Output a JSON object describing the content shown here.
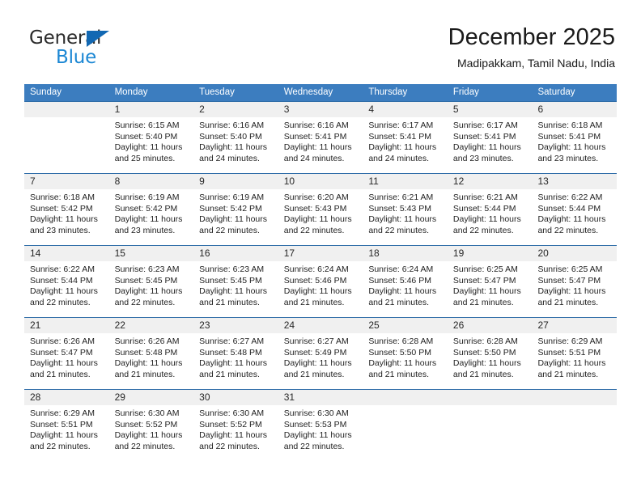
{
  "brand": {
    "name_top": "General",
    "name_bottom": "Blue",
    "accent_color": "#1b87d4",
    "triangle_color": "#1268b3"
  },
  "header": {
    "title": "December 2025",
    "subtitle": "Madipakkam, Tamil Nadu, India"
  },
  "theme": {
    "header_bg": "#3c7dbf",
    "row_divider": "#2f6da8",
    "daynum_band": "#f0f0f0",
    "text": "#1f1f1f"
  },
  "weekdays": [
    "Sunday",
    "Monday",
    "Tuesday",
    "Wednesday",
    "Thursday",
    "Friday",
    "Saturday"
  ],
  "weeks": [
    [
      {
        "day": "",
        "sunrise": "",
        "sunset": "",
        "daylight": ""
      },
      {
        "day": "1",
        "sunrise": "Sunrise: 6:15 AM",
        "sunset": "Sunset: 5:40 PM",
        "daylight": "Daylight: 11 hours and 25 minutes."
      },
      {
        "day": "2",
        "sunrise": "Sunrise: 6:16 AM",
        "sunset": "Sunset: 5:40 PM",
        "daylight": "Daylight: 11 hours and 24 minutes."
      },
      {
        "day": "3",
        "sunrise": "Sunrise: 6:16 AM",
        "sunset": "Sunset: 5:41 PM",
        "daylight": "Daylight: 11 hours and 24 minutes."
      },
      {
        "day": "4",
        "sunrise": "Sunrise: 6:17 AM",
        "sunset": "Sunset: 5:41 PM",
        "daylight": "Daylight: 11 hours and 24 minutes."
      },
      {
        "day": "5",
        "sunrise": "Sunrise: 6:17 AM",
        "sunset": "Sunset: 5:41 PM",
        "daylight": "Daylight: 11 hours and 23 minutes."
      },
      {
        "day": "6",
        "sunrise": "Sunrise: 6:18 AM",
        "sunset": "Sunset: 5:41 PM",
        "daylight": "Daylight: 11 hours and 23 minutes."
      }
    ],
    [
      {
        "day": "7",
        "sunrise": "Sunrise: 6:18 AM",
        "sunset": "Sunset: 5:42 PM",
        "daylight": "Daylight: 11 hours and 23 minutes."
      },
      {
        "day": "8",
        "sunrise": "Sunrise: 6:19 AM",
        "sunset": "Sunset: 5:42 PM",
        "daylight": "Daylight: 11 hours and 23 minutes."
      },
      {
        "day": "9",
        "sunrise": "Sunrise: 6:19 AM",
        "sunset": "Sunset: 5:42 PM",
        "daylight": "Daylight: 11 hours and 22 minutes."
      },
      {
        "day": "10",
        "sunrise": "Sunrise: 6:20 AM",
        "sunset": "Sunset: 5:43 PM",
        "daylight": "Daylight: 11 hours and 22 minutes."
      },
      {
        "day": "11",
        "sunrise": "Sunrise: 6:21 AM",
        "sunset": "Sunset: 5:43 PM",
        "daylight": "Daylight: 11 hours and 22 minutes."
      },
      {
        "day": "12",
        "sunrise": "Sunrise: 6:21 AM",
        "sunset": "Sunset: 5:44 PM",
        "daylight": "Daylight: 11 hours and 22 minutes."
      },
      {
        "day": "13",
        "sunrise": "Sunrise: 6:22 AM",
        "sunset": "Sunset: 5:44 PM",
        "daylight": "Daylight: 11 hours and 22 minutes."
      }
    ],
    [
      {
        "day": "14",
        "sunrise": "Sunrise: 6:22 AM",
        "sunset": "Sunset: 5:44 PM",
        "daylight": "Daylight: 11 hours and 22 minutes."
      },
      {
        "day": "15",
        "sunrise": "Sunrise: 6:23 AM",
        "sunset": "Sunset: 5:45 PM",
        "daylight": "Daylight: 11 hours and 22 minutes."
      },
      {
        "day": "16",
        "sunrise": "Sunrise: 6:23 AM",
        "sunset": "Sunset: 5:45 PM",
        "daylight": "Daylight: 11 hours and 21 minutes."
      },
      {
        "day": "17",
        "sunrise": "Sunrise: 6:24 AM",
        "sunset": "Sunset: 5:46 PM",
        "daylight": "Daylight: 11 hours and 21 minutes."
      },
      {
        "day": "18",
        "sunrise": "Sunrise: 6:24 AM",
        "sunset": "Sunset: 5:46 PM",
        "daylight": "Daylight: 11 hours and 21 minutes."
      },
      {
        "day": "19",
        "sunrise": "Sunrise: 6:25 AM",
        "sunset": "Sunset: 5:47 PM",
        "daylight": "Daylight: 11 hours and 21 minutes."
      },
      {
        "day": "20",
        "sunrise": "Sunrise: 6:25 AM",
        "sunset": "Sunset: 5:47 PM",
        "daylight": "Daylight: 11 hours and 21 minutes."
      }
    ],
    [
      {
        "day": "21",
        "sunrise": "Sunrise: 6:26 AM",
        "sunset": "Sunset: 5:47 PM",
        "daylight": "Daylight: 11 hours and 21 minutes."
      },
      {
        "day": "22",
        "sunrise": "Sunrise: 6:26 AM",
        "sunset": "Sunset: 5:48 PM",
        "daylight": "Daylight: 11 hours and 21 minutes."
      },
      {
        "day": "23",
        "sunrise": "Sunrise: 6:27 AM",
        "sunset": "Sunset: 5:48 PM",
        "daylight": "Daylight: 11 hours and 21 minutes."
      },
      {
        "day": "24",
        "sunrise": "Sunrise: 6:27 AM",
        "sunset": "Sunset: 5:49 PM",
        "daylight": "Daylight: 11 hours and 21 minutes."
      },
      {
        "day": "25",
        "sunrise": "Sunrise: 6:28 AM",
        "sunset": "Sunset: 5:50 PM",
        "daylight": "Daylight: 11 hours and 21 minutes."
      },
      {
        "day": "26",
        "sunrise": "Sunrise: 6:28 AM",
        "sunset": "Sunset: 5:50 PM",
        "daylight": "Daylight: 11 hours and 21 minutes."
      },
      {
        "day": "27",
        "sunrise": "Sunrise: 6:29 AM",
        "sunset": "Sunset: 5:51 PM",
        "daylight": "Daylight: 11 hours and 21 minutes."
      }
    ],
    [
      {
        "day": "28",
        "sunrise": "Sunrise: 6:29 AM",
        "sunset": "Sunset: 5:51 PM",
        "daylight": "Daylight: 11 hours and 22 minutes."
      },
      {
        "day": "29",
        "sunrise": "Sunrise: 6:30 AM",
        "sunset": "Sunset: 5:52 PM",
        "daylight": "Daylight: 11 hours and 22 minutes."
      },
      {
        "day": "30",
        "sunrise": "Sunrise: 6:30 AM",
        "sunset": "Sunset: 5:52 PM",
        "daylight": "Daylight: 11 hours and 22 minutes."
      },
      {
        "day": "31",
        "sunrise": "Sunrise: 6:30 AM",
        "sunset": "Sunset: 5:53 PM",
        "daylight": "Daylight: 11 hours and 22 minutes."
      },
      {
        "day": "",
        "sunrise": "",
        "sunset": "",
        "daylight": ""
      },
      {
        "day": "",
        "sunrise": "",
        "sunset": "",
        "daylight": ""
      },
      {
        "day": "",
        "sunrise": "",
        "sunset": "",
        "daylight": ""
      }
    ]
  ]
}
